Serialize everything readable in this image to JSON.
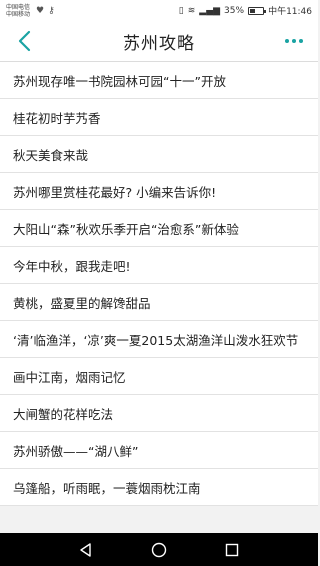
{
  "status_bar": {
    "carrier_line1": "中国电信",
    "carrier_line2": "中国移动",
    "battery_percent_text": "35%",
    "battery_level": 0.35,
    "time": "中午11:46"
  },
  "header": {
    "title": "苏州攻略",
    "back_icon": "chevron-left-icon",
    "more_icon": "more-dots-icon",
    "accent_color": "#1aa3a3"
  },
  "articles": [
    "苏州现存唯一书院园林可园“十一”开放",
    "桂花初时芋艿香",
    "秋天美食来哉",
    "苏州哪里赏桂花最好? 小编来告诉你!",
    "大阳山“森”秋欢乐季开启“治愈系”新体验",
    "今年中秋，跟我走吧!",
    "黄桃，盛夏里的解馋甜品",
    "‘清’临渔洋，‘凉’爽一夏2015太湖渔洋山泼水狂欢节",
    "画中江南，烟雨记忆",
    "大闸蟹的花样吃法",
    "苏州骄傲——“湖八鲜”",
    "乌篷船，听雨眠，一蓑烟雨枕江南"
  ],
  "nav": {
    "back_icon": "triangle-back-icon",
    "home_icon": "circle-home-icon",
    "recent_icon": "square-recent-icon"
  }
}
